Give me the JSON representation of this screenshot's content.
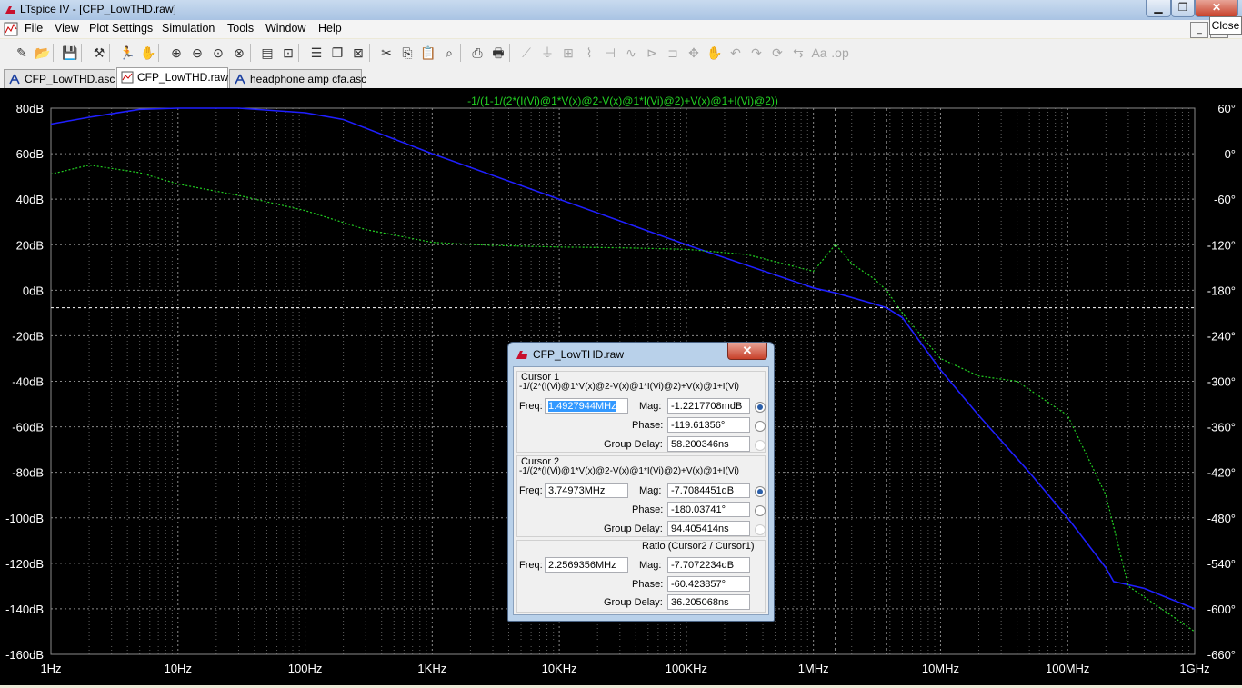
{
  "window": {
    "title": "LTspice IV - [CFP_LowTHD.raw]",
    "minimize_glyph": "▁",
    "restore_glyph": "❐",
    "close_glyph": "✕",
    "close_tooltip": "Close"
  },
  "menu": [
    "File",
    "View",
    "Plot Settings",
    "Simulation",
    "Tools",
    "Window",
    "Help"
  ],
  "mdi_buttons": [
    "_",
    "❐"
  ],
  "toolbar_icons": [
    "new-schematic-icon",
    "open-icon",
    "save-icon",
    "control-panel-icon",
    "run-icon",
    "halt-icon",
    "zoom-area-icon",
    "zoom-out-icon",
    "zoom-full-icon",
    "zoom-cancel-icon",
    "autorange-icon",
    "mark-unconnected-icon",
    "tile-horizontal-icon",
    "cascade-icon",
    "close-window-icon",
    "cut-icon",
    "copy-icon",
    "paste-icon",
    "find-icon",
    "print-setup-icon",
    "print-icon",
    "wire-icon",
    "ground-icon",
    "label-icon",
    "resistor-icon",
    "capacitor-icon",
    "inductor-icon",
    "diode-icon",
    "component-icon",
    "move-icon",
    "drag-icon",
    "undo-icon",
    "redo-icon",
    "rotate-icon",
    "mirror-icon",
    "text-icon",
    "spice-directive-icon"
  ],
  "tabs": [
    {
      "label": "CFP_LowTHD.asc",
      "icon": "schematic-icon",
      "active": false
    },
    {
      "label": "CFP_LowTHD.raw",
      "icon": "waveform-icon",
      "active": true
    },
    {
      "label": "headphone amp cfa.asc",
      "icon": "schematic-icon",
      "active": false
    }
  ],
  "colors": {
    "plot_bg": "#000000",
    "grid": "#8a8a8a",
    "magnitude_trace": "#1f1fff",
    "phase_trace": "#22d022",
    "cursor_line": "#ffffff",
    "axis_text": "#ffffff"
  },
  "chart_data": {
    "type": "line",
    "title": "-1/(1-1/(2*(I(Vi)@1*V(x)@2-V(x)@1*I(Vi)@2)+V(x)@1+I(Vi)@2))",
    "xscale": "log",
    "xlim": [
      1,
      1000000000
    ],
    "x_ticks": [
      "1Hz",
      "10Hz",
      "100Hz",
      "1KHz",
      "10KHz",
      "100KHz",
      "1MHz",
      "10MHz",
      "100MHz",
      "1GHz"
    ],
    "y_left_ticks": [
      "80dB",
      "60dB",
      "40dB",
      "20dB",
      "0dB",
      "-20dB",
      "-40dB",
      "-60dB",
      "-80dB",
      "-100dB",
      "-120dB",
      "-140dB",
      "-160dB"
    ],
    "y_left_lim": [
      -160,
      80
    ],
    "y_right_ticks": [
      "60°",
      "0°",
      "-60°",
      "-120°",
      "-180°",
      "-240°",
      "-300°",
      "-360°",
      "-420°",
      "-480°",
      "-540°",
      "-600°",
      "-660°"
    ],
    "y_right_lim": [
      -660,
      60
    ],
    "grid": true,
    "series": [
      {
        "axis": "left",
        "x": [
          1,
          2,
          5,
          10,
          30,
          100,
          200,
          1000,
          10000,
          100000,
          1000000,
          1492794,
          3000000,
          3749730,
          5000000,
          10000000,
          20000000,
          50000000,
          100000000,
          200000000,
          230000000,
          400000000,
          1000000000
        ],
        "values": [
          73,
          76,
          79.5,
          80,
          80,
          78,
          75,
          60,
          40,
          20,
          1,
          -1.2,
          -6,
          -7.7,
          -12,
          -35,
          -55,
          -80,
          -100,
          -122,
          -128,
          -131,
          -140
        ]
      },
      {
        "axis": "right",
        "line": "dashed",
        "x": [
          1,
          2,
          5,
          10,
          30,
          100,
          300,
          1000,
          3000,
          10000,
          30000,
          100000,
          300000,
          1000000,
          1492794,
          2000000,
          3000000,
          3749730,
          5000000,
          10000000,
          20000000,
          40000000,
          100000000,
          200000000,
          300000000,
          1000000000
        ],
        "values": [
          -27,
          -15,
          -25,
          -40,
          -55,
          -75,
          -100,
          -117,
          -121,
          -123,
          -124,
          -126,
          -133,
          -155,
          -119.6,
          -145,
          -165,
          -180,
          -210,
          -270,
          -293,
          -300,
          -345,
          -450,
          -570,
          -630
        ]
      }
    ],
    "cursors": [
      {
        "freq": 1492794,
        "mag_db": -1.2217708,
        "phase": -119.61356
      },
      {
        "freq": 3749730,
        "mag_db": -7.7084451,
        "phase": -180.03741
      }
    ]
  },
  "dialog": {
    "title": "CFP_LowTHD.raw",
    "close_glyph": "✕",
    "cursor1": {
      "label": "Cursor 1",
      "expr": "-1/(2*(I(Vi)@1*V(x)@2-V(x)@1*I(Vi)@2)+V(x)@1+I(Vi)",
      "freq_label": "Freq:",
      "freq": "1.4927944MHz",
      "mag_label": "Mag:",
      "mag": "-1.2217708mdB",
      "phase_label": "Phase:",
      "phase": "-119.61356°",
      "gd_label": "Group Delay:",
      "gd": "58.200346ns"
    },
    "cursor2": {
      "label": "Cursor 2",
      "expr": "-1/(2*(I(Vi)@1*V(x)@2-V(x)@1*I(Vi)@2)+V(x)@1+I(Vi)",
      "freq_label": "Freq:",
      "freq": "3.74973MHz",
      "mag_label": "Mag:",
      "mag": "-7.7084451dB",
      "phase_label": "Phase:",
      "phase": "-180.03741°",
      "gd_label": "Group Delay:",
      "gd": "94.405414ns"
    },
    "ratio": {
      "label": "Ratio (Cursor2 / Cursor1)",
      "freq_label": "Freq:",
      "freq": "2.2569356MHz",
      "mag_label": "Mag:",
      "mag": "-7.7072234dB",
      "phase_label": "Phase:",
      "phase": "-60.423857°",
      "gd_label": "Group Delay:",
      "gd": "36.205068ns"
    }
  }
}
